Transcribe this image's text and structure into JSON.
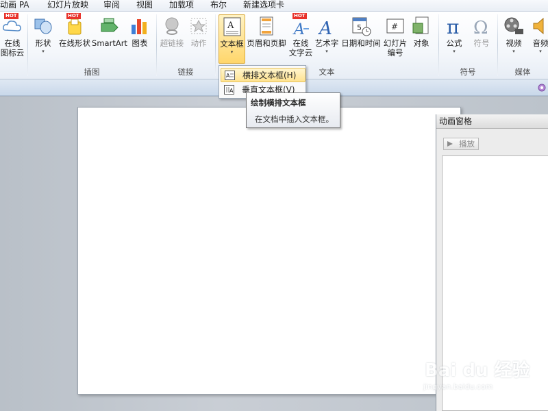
{
  "menu_tabs": [
    "动画 PA",
    "幻灯片放映",
    "审阅",
    "视图",
    "加载项",
    "布尔",
    "新建选项卡"
  ],
  "ribbon": {
    "buttons": {
      "online_icons": [
        "在线",
        "图标云"
      ],
      "shapes": "形状",
      "online_shapes": "在线形状",
      "smartart": "SmartArt",
      "chart": "图表",
      "hyperlink": "超链接",
      "action": "动作",
      "textbox": "文本框",
      "header_footer": "页眉和页脚",
      "online_text_cloud": [
        "在线",
        "文字云"
      ],
      "wordart": "艺术字",
      "datetime": "日期和时间",
      "slide_number": [
        "幻灯片",
        "编号"
      ],
      "object": "对象",
      "equation": "公式",
      "symbol": "符号",
      "video": "视频",
      "audio": "音频"
    },
    "hot_badge": "HOT",
    "dropdown_arrow": "▾",
    "groups": {
      "illustrations": "插图",
      "links": "链接",
      "text": "文本",
      "symbols": "符号",
      "media": "媒体"
    }
  },
  "textbox_menu": {
    "horizontal": "横排文本框(H)",
    "vertical": "垂直文本框(V)"
  },
  "tooltip": {
    "title": "绘制横排文本框",
    "body": "在文档中插入文本框。"
  },
  "animation_pane": {
    "title": "动画窗格",
    "play_label": "播放"
  },
  "watermark": {
    "brand": "Bai du 经验",
    "sub": "jingyan.baidu.com"
  },
  "colors": {
    "active_button": "#ffd66b",
    "hot_badge": "#e8322b",
    "ribbon_blue": "#2b579a"
  }
}
